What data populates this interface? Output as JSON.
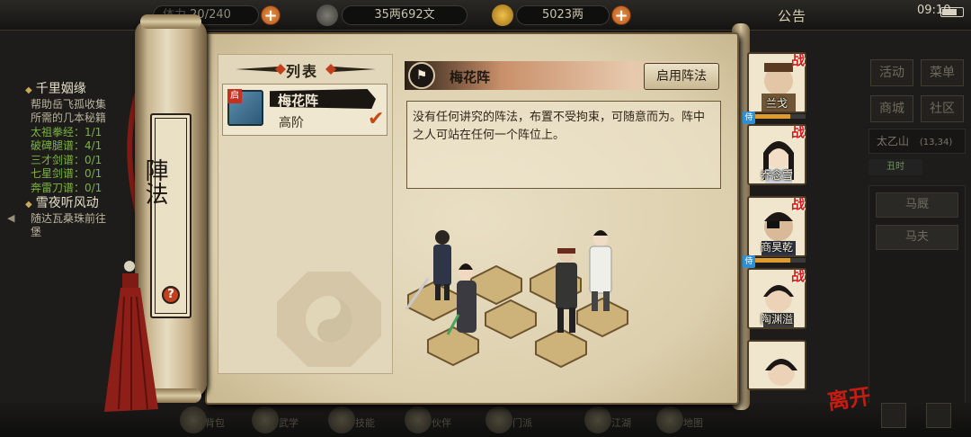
{
  "topbar": {
    "stamina": "20/240",
    "stamina_partial": "体力",
    "money": "35两692文",
    "gold": "5023两",
    "notice": "公告",
    "clock": "09:10"
  },
  "quest": {
    "q1_title": "千里姻缘",
    "q1_text_1": "帮助岳飞孤收集",
    "q1_text_2": "所需的几本秘籍",
    "items": [
      "太祖拳经：1/1",
      "破碑腿谱：4/1",
      "三才剑谱：0/1",
      "七星剑谱：0/1",
      "奔雷刀谱：0/1"
    ],
    "q2_title": "雪夜听风动",
    "q2_text_1": "随达瓦桑珠前往",
    "q2_text_2": "堡"
  },
  "right_menu": {
    "activity": "活动",
    "menu": "菜单",
    "shop": "商城",
    "community": "社区",
    "location": "太乙山",
    "location_coords": "(13,34)",
    "time_tag": "丑时",
    "npc1": "马厩",
    "npc2": "马夫"
  },
  "scroll": {
    "title": "陣法",
    "help": "?"
  },
  "list": {
    "header": "列表",
    "item_tag": "启",
    "item_name": "梅花阵",
    "item_level": "高阶"
  },
  "detail": {
    "title": "梅花阵",
    "enable_button": "启用阵法",
    "description": "没有任何讲究的阵法，布置不受拘束，可随意而为。阵中之人可站在任何一个阵位上。"
  },
  "party": [
    {
      "name": "兰戈",
      "tag": "战",
      "leader": true
    },
    {
      "name": "乔念雪",
      "tag": "战",
      "leader": false
    },
    {
      "name": "商昊乾",
      "tag": "战",
      "leader": true
    },
    {
      "name": "陶渊溢",
      "tag": "战",
      "leader": false
    },
    {
      "name": "",
      "tag": "",
      "leader": false
    }
  ],
  "leader_badge": "侍",
  "leave": "离开",
  "bottom": [
    "背包",
    "武学",
    "技能",
    "伙伴",
    "门派",
    "江湖",
    "地图"
  ],
  "colors": {
    "accent_red": "#c41c12",
    "paper": "#e2d7ba",
    "quest_green": "#7bb43f",
    "plus_orange": "#d97a35"
  }
}
